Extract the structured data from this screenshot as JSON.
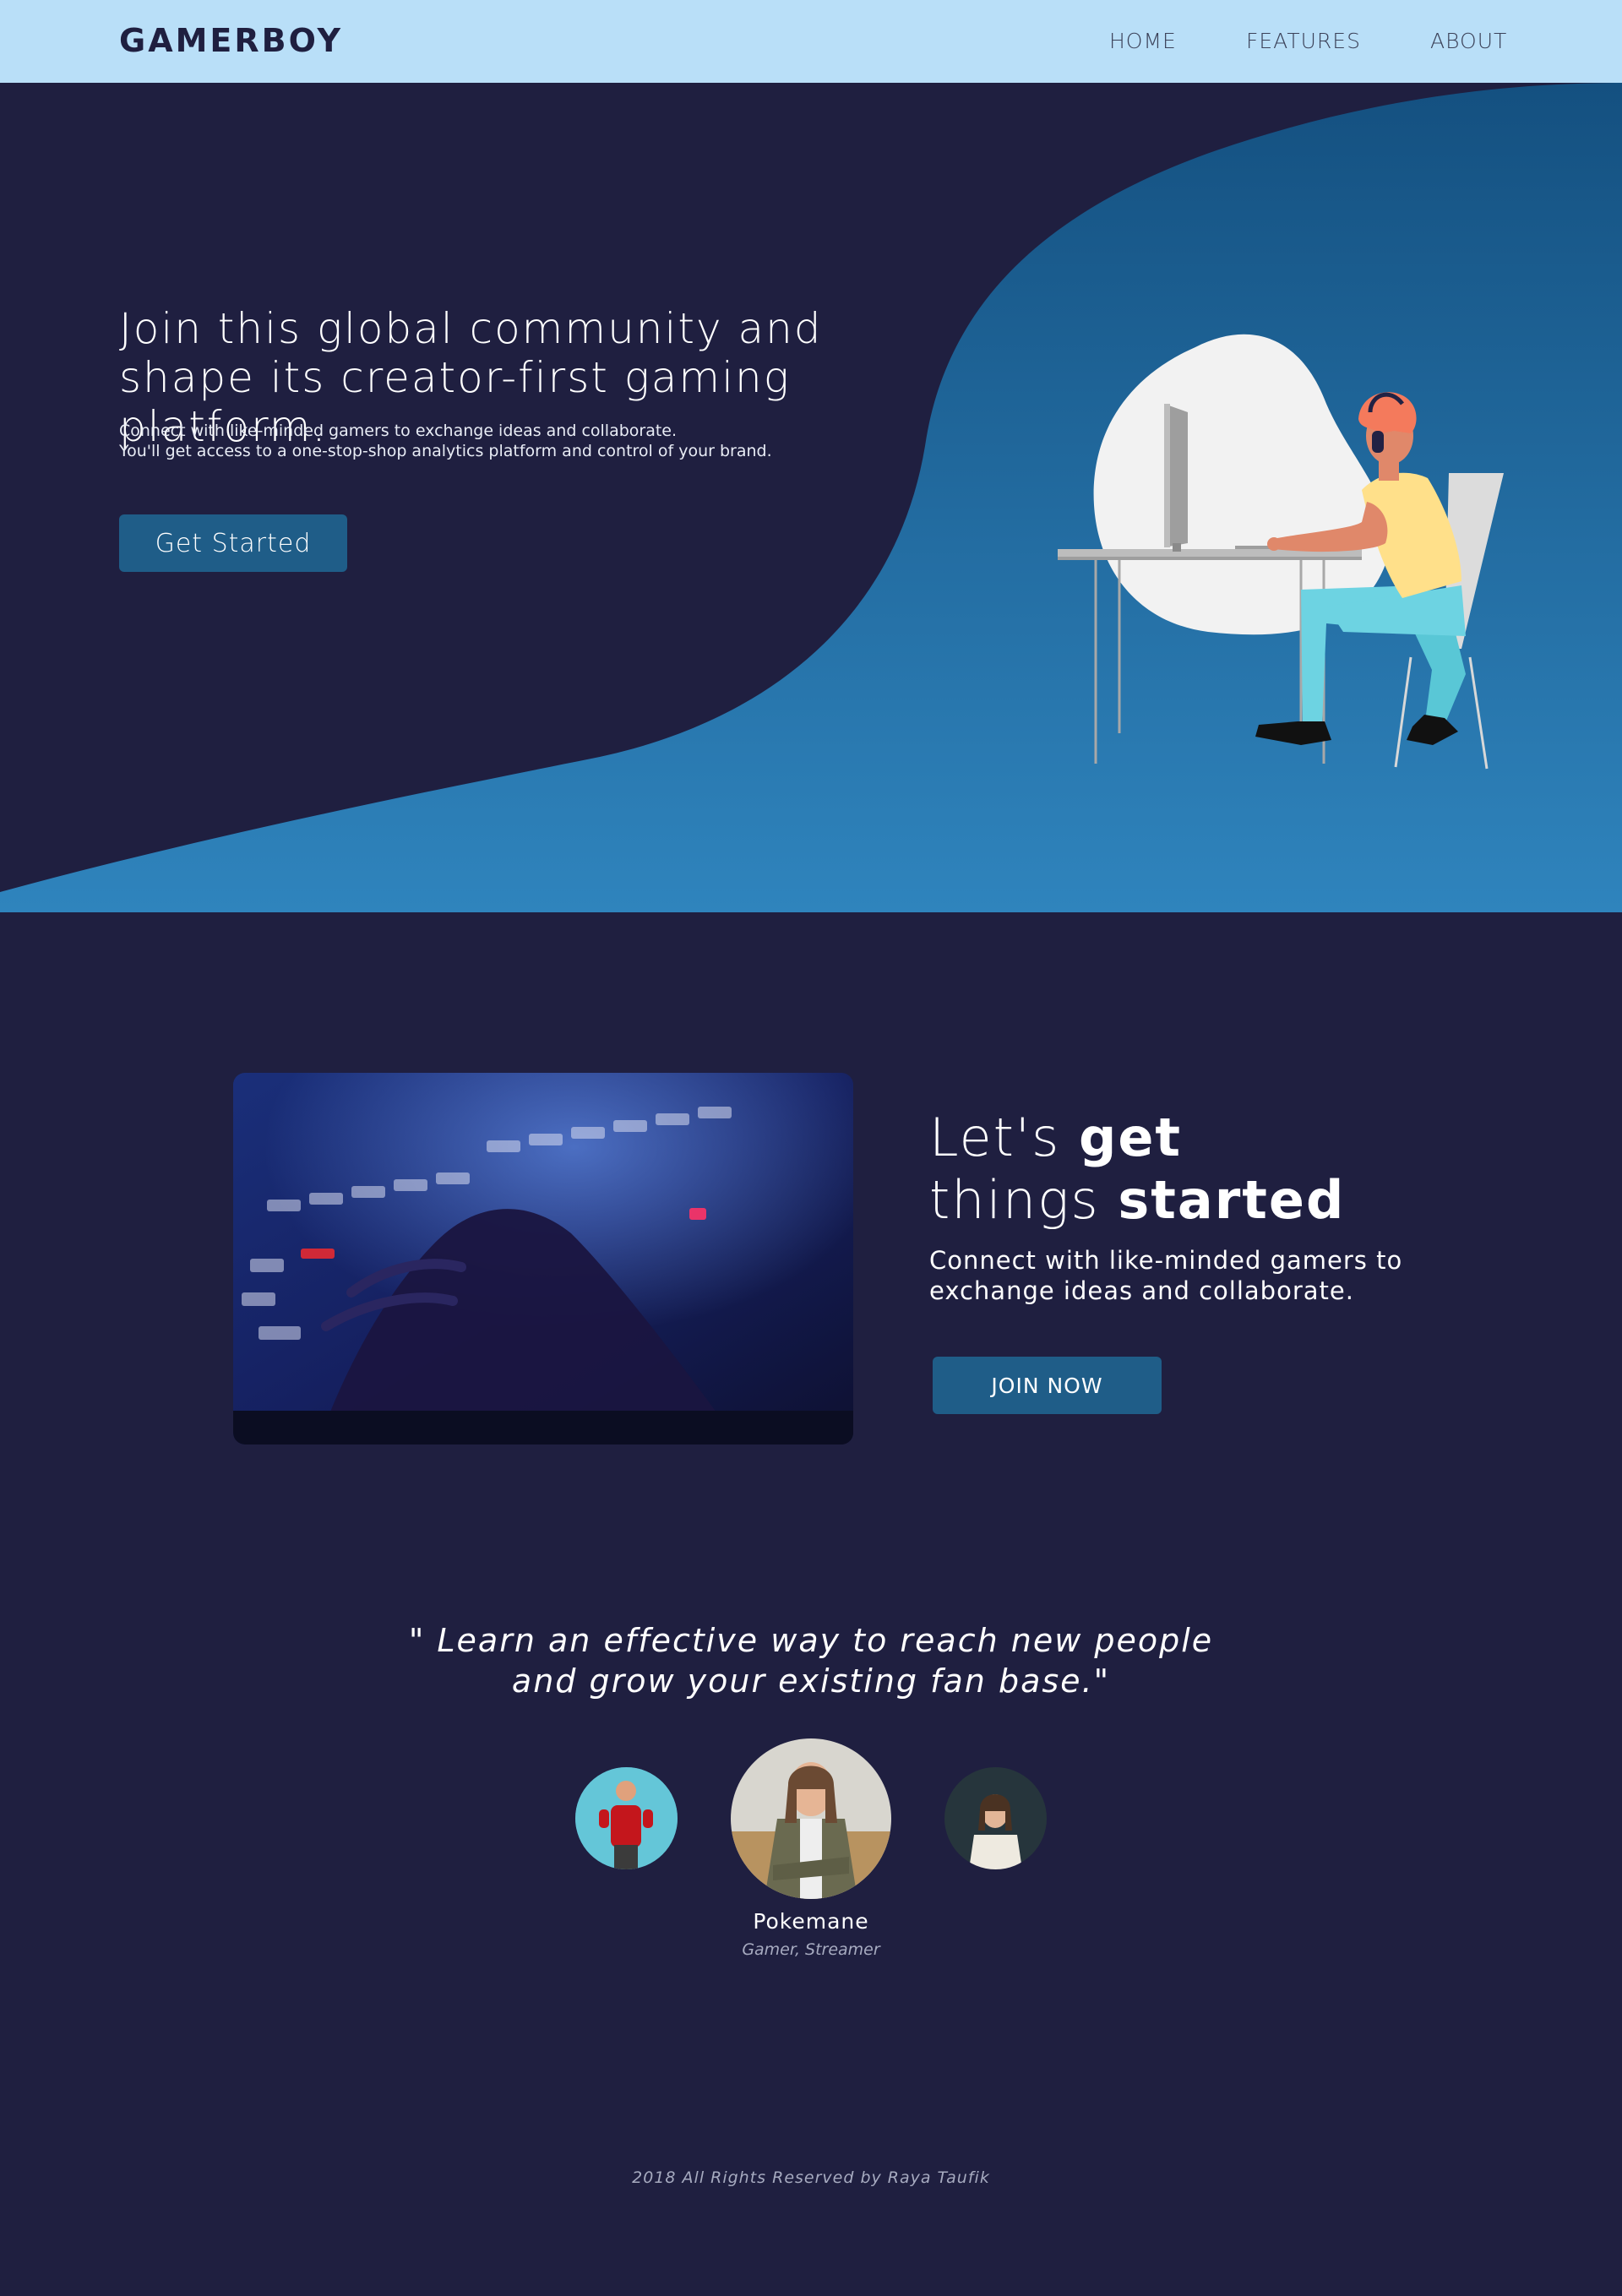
{
  "nav": {
    "brand": "GAMERBOY",
    "links": [
      "HOME",
      "FEATURES",
      "ABOUT"
    ]
  },
  "hero": {
    "title": "Join this global community and shape its creator-first gaming platform.",
    "desc_line1": "Connect with like-minded gamers to exchange ideas and collaborate.",
    "desc_line2": "You'll get access to a one-stop-shop analytics platform and control of your brand.",
    "cta": "Get Started"
  },
  "feature": {
    "title_line1_light": "Let's ",
    "title_line1_bold": "get",
    "title_line2_light": "things ",
    "title_line2_bold": "started",
    "desc": "Connect with like-minded gamers to exchange ideas and collaborate.",
    "cta": "JOIN NOW"
  },
  "testimonial": {
    "quote": "\" Learn an effective way to reach new people and grow your existing fan base.\"",
    "name": "Pokemane",
    "role": "Gamer, Streamer"
  },
  "footer": {
    "text": "2018 All Rights Reserved by Raya Taufik"
  },
  "colors": {
    "nav_bg": "#b9dff8",
    "page_bg": "#1f1f40",
    "button": "#1f5d88",
    "hero_gradient_top": "#145080",
    "hero_gradient_bottom": "#2f84bd"
  }
}
